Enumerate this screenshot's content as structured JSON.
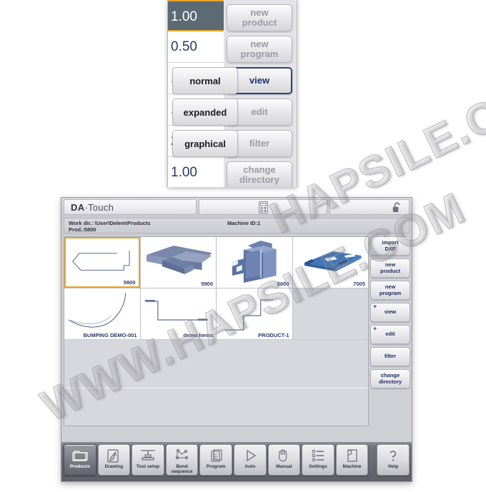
{
  "watermark": {
    "left_text": "WWW.HAPSILE.COM",
    "right_text": "HAPSILE.COM"
  },
  "float_panel": {
    "value_rows": [
      {
        "value": "1.00",
        "selected": true
      },
      {
        "value": "0.50",
        "selected": false
      },
      {
        "value": "1",
        "selected": false
      },
      {
        "value": "1",
        "selected": false
      },
      {
        "value": "2",
        "selected": false
      },
      {
        "value": "1.00",
        "selected": false
      }
    ],
    "view_mode_buttons": [
      {
        "label": "normal"
      },
      {
        "label": "expanded"
      },
      {
        "label": "graphical"
      }
    ],
    "action_buttons": [
      {
        "label": "new\nproduct",
        "state": "disabled",
        "plus": false
      },
      {
        "label": "new\nprogram",
        "state": "disabled",
        "plus": false
      },
      {
        "label": "view",
        "state": "active",
        "plus": true
      },
      {
        "label": "edit",
        "state": "disabled",
        "plus": true
      },
      {
        "label": "filter",
        "state": "disabled",
        "plus": false
      },
      {
        "label": "change\ndirectory",
        "state": "disabled",
        "plus": false
      }
    ]
  },
  "app": {
    "brand_bold": "DA",
    "brand_rest": "·Touch",
    "icons": {
      "keypad": "calculator-icon",
      "lock": "unlock-icon"
    },
    "info": {
      "work_dir": "Work dir.: \\User\\Delem\\Products",
      "product": "Prod.:5800",
      "machine_id": "Machine ID:1"
    },
    "products": [
      {
        "label": "5800",
        "thumb": "outline-bracket",
        "selected": true,
        "empty": false
      },
      {
        "label": "5900",
        "thumb": "iso-tray",
        "selected": false,
        "empty": false
      },
      {
        "label": "6000",
        "thumb": "iso-cabinet",
        "selected": false,
        "empty": false
      },
      {
        "label": "7005",
        "thumb": "iso-flat-plate",
        "selected": false,
        "empty": false
      },
      {
        "label": "BUMPING DEMO-001",
        "thumb": "curve-bump",
        "selected": false,
        "empty": false
      },
      {
        "label": "demo hems",
        "thumb": "hem-profile",
        "selected": false,
        "empty": false
      },
      {
        "label": "PRODUCT-1",
        "thumb": "step-profile",
        "selected": false,
        "empty": false
      },
      {
        "label": "",
        "thumb": "",
        "selected": false,
        "empty": true
      }
    ],
    "side_buttons": [
      {
        "label": "import\nDXF",
        "plus": false
      },
      {
        "label": "new\nproduct",
        "plus": false
      },
      {
        "label": "new\nprogram",
        "plus": false
      },
      {
        "label": "view",
        "plus": true
      },
      {
        "label": "edit",
        "plus": true
      },
      {
        "label": "filter",
        "plus": false
      },
      {
        "label": "change\ndirectory",
        "plus": false
      }
    ],
    "toolbar": [
      {
        "label": "Products",
        "icon": "folder-icon",
        "active": true
      },
      {
        "label": "Drawing",
        "icon": "pencil-page-icon",
        "active": false
      },
      {
        "label": "Tool setup",
        "icon": "press-tool-icon",
        "active": false
      },
      {
        "label": "Bend\nsequence",
        "icon": "bend-sequence-icon",
        "active": false
      },
      {
        "label": "Program",
        "icon": "pages-stack-icon",
        "active": false
      },
      {
        "label": "Auto",
        "icon": "play-triangle-icon",
        "active": false
      },
      {
        "label": "Manual",
        "icon": "hand-icon",
        "active": false
      },
      {
        "label": "Settings",
        "icon": "sliders-list-icon",
        "active": false
      },
      {
        "label": "Machine",
        "icon": "machine-page-icon",
        "active": false
      },
      {
        "label": "Help",
        "icon": "question-mark-icon",
        "active": false
      }
    ]
  },
  "colors": {
    "accent_orange": "#e8a52a",
    "accent_blue": "#28407e",
    "label_blue": "#2b3a6b",
    "toolbar_dark": "#6b6b74",
    "selected_row_bg": "#5c6a74"
  }
}
